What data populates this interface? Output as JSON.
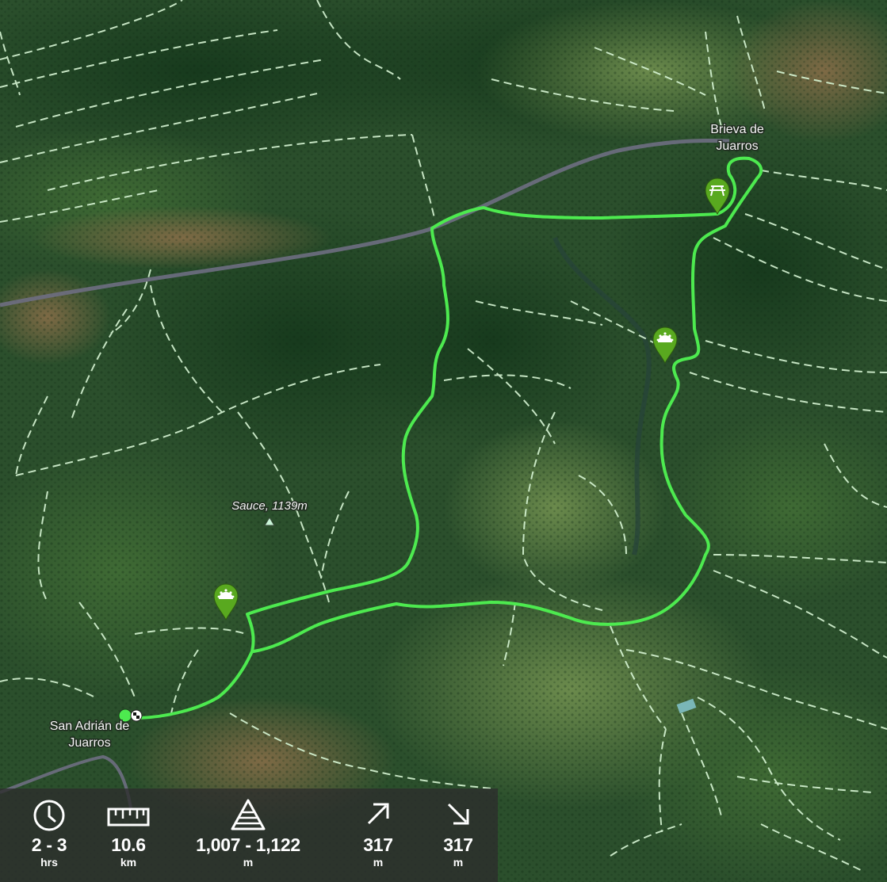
{
  "map": {
    "places": [
      {
        "id": "brieva",
        "lines": [
          "Brieva de",
          "Juarros"
        ]
      },
      {
        "id": "san-adrian",
        "lines": [
          "San Adrián de",
          "Juarros"
        ]
      }
    ],
    "peak": {
      "label": "Sauce, 1139m"
    },
    "markers": [
      {
        "id": "picnic",
        "icon": "picnic-table-icon"
      },
      {
        "id": "viewpoint-1",
        "icon": "viewpoint-icon"
      },
      {
        "id": "viewpoint-2",
        "icon": "viewpoint-icon"
      }
    ],
    "colors": {
      "route": "#4dea4f",
      "trail": "#d7f5d4",
      "road": "#6e6e82",
      "marker": "#59a91f"
    }
  },
  "stats": {
    "time": {
      "icon": "clock-icon",
      "value": "2 - 3",
      "unit": "hrs"
    },
    "distance": {
      "icon": "ruler-icon",
      "value": "10.6",
      "unit": "km"
    },
    "altitude": {
      "icon": "altitude-icon",
      "value": "1,007 - 1,122",
      "unit": "m"
    },
    "ascent": {
      "icon": "arrow-up-right-icon",
      "value": "317",
      "unit": "m"
    },
    "descent": {
      "icon": "arrow-down-right-icon",
      "value": "317",
      "unit": "m"
    }
  }
}
